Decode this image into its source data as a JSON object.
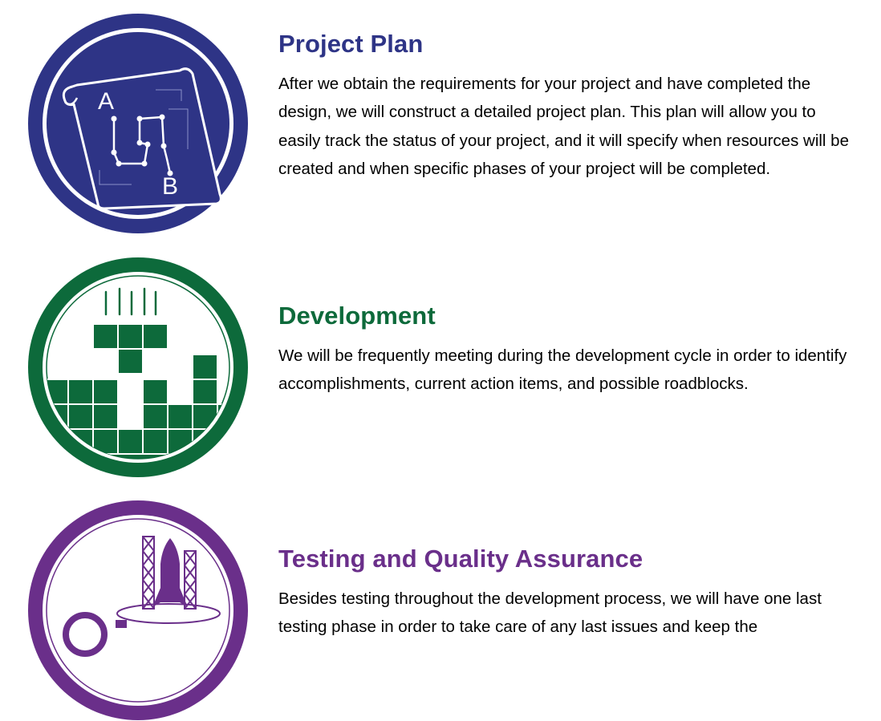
{
  "colors": {
    "project_plan": "#2e3486",
    "development": "#0d6a3b",
    "testing": "#6a2f8a",
    "body_text": "#000000",
    "background": "#ffffff"
  },
  "sections": [
    {
      "title": "Project Plan",
      "description": "After we obtain the requirements for your project and have completed the design, we will construct a detailed project plan. This plan will allow you to easily track the status of your project, and it will specify when resources will be created and when specific phases of your project will be completed.",
      "icon": "blueprint-icon",
      "icon_labels": {
        "a": "A",
        "b": "B"
      }
    },
    {
      "title": "Development",
      "description": "We will be frequently meeting during the development cycle in order to identify accomplishments, current action items, and possible roadblocks.",
      "icon": "falling-blocks-icon"
    },
    {
      "title": "Testing and Quality Assurance",
      "description": "Besides testing throughout the development process, we will have one last testing phase in order to take care of any last issues and keep the",
      "icon": "rocket-launch-icon"
    }
  ]
}
